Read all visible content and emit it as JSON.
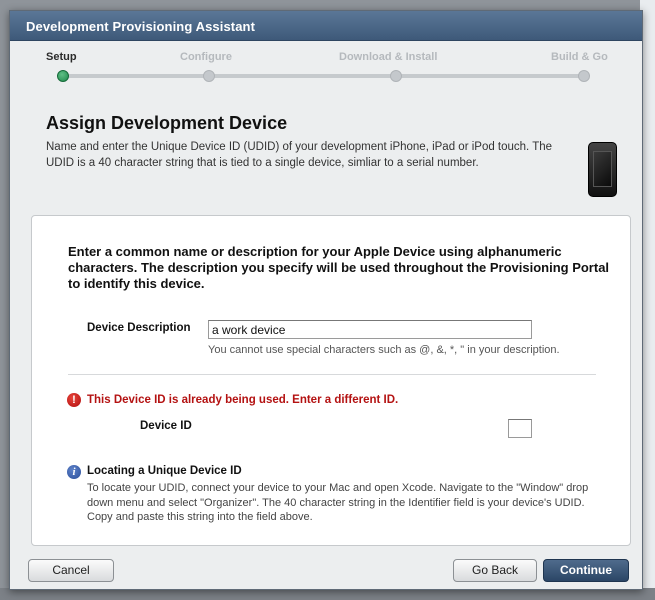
{
  "window": {
    "title": "Development Provisioning Assistant"
  },
  "steps": [
    {
      "label": "Setup",
      "active": true
    },
    {
      "label": "Configure",
      "active": false
    },
    {
      "label": "Download & Install",
      "active": false
    },
    {
      "label": "Build & Go",
      "active": false
    }
  ],
  "header": {
    "title": "Assign Development Device",
    "description": "Name and enter the Unique Device ID (UDID) of your development iPhone, iPad or iPod touch. The UDID is a 40 character string that is tied to a single device, simliar to a serial number.",
    "icon": "iphone-icon"
  },
  "form": {
    "intro": "Enter a common name or description for your Apple Device using alphanumeric characters. The description you specify will be used throughout the Provisioning Portal to identify this device.",
    "device_description": {
      "label": "Device Description",
      "value": "a work device",
      "hint": "You cannot use special characters such as @, &, *, \" in your description."
    },
    "error": {
      "icon": "error-icon",
      "message": "This Device ID is already being used. Enter a different ID.",
      "color": "#b41212"
    },
    "device_id": {
      "label": "Device ID",
      "value": ""
    },
    "info": {
      "icon": "info-icon",
      "title": "Locating a Unique Device ID",
      "body": "To locate your UDID, connect your device to your Mac and open Xcode. Navigate to the \"Window\" drop down menu and select \"Organizer\". The 40 character string in the Identifier field is your device's UDID. Copy and paste this string into the field above."
    }
  },
  "footer": {
    "cancel": "Cancel",
    "go_back": "Go Back",
    "continue": "Continue"
  },
  "colors": {
    "titlebar": "#3e5979",
    "accent_green": "#1f8a4c",
    "primary_button": "#2b4666"
  }
}
